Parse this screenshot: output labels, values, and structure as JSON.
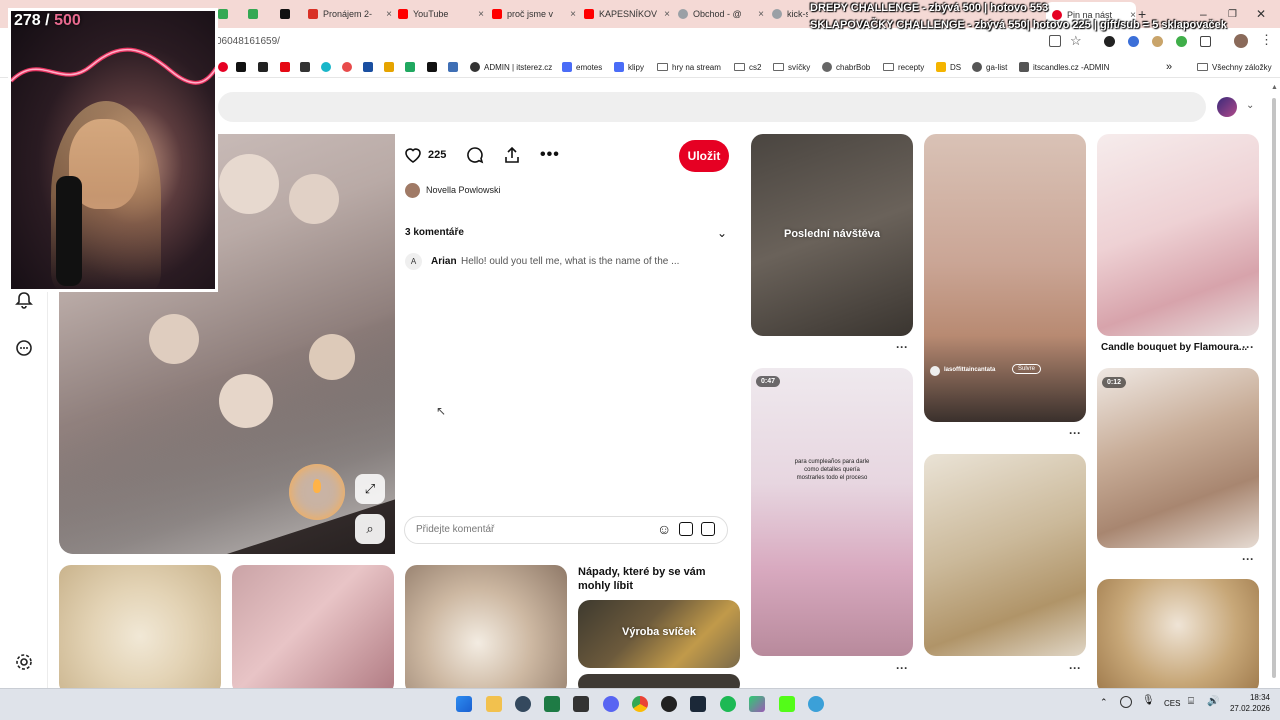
{
  "browser": {
    "tabs": [
      {
        "label": "Pronájem 2-",
        "color": "#d93025"
      },
      {
        "label": "YouTube",
        "color": "#ff0000"
      },
      {
        "label": "proč jsme v",
        "color": "#ff0000"
      },
      {
        "label": "KAPESNÍKOV",
        "color": "#ff0000"
      },
      {
        "label": "Obchod - @",
        "color": "#9aa0a6"
      },
      {
        "label": "kick-s",
        "color": "#9aa0a6"
      },
      {
        "label": "Pin na nást",
        "color": "#e60023"
      }
    ],
    "url": "06048161659/",
    "bookmarks": [
      {
        "label": "ADMIN | itsterez.cz",
        "color": "#333"
      },
      {
        "label": "emotes",
        "color": "#4a6cf7"
      },
      {
        "label": "klipy",
        "color": "#4a6cf7"
      },
      {
        "label": "hry na stream",
        "color": "folder"
      },
      {
        "label": "cs2",
        "color": "folder"
      },
      {
        "label": "svíčky",
        "color": "folder"
      },
      {
        "label": "chabrBob",
        "color": "#666"
      },
      {
        "label": "recepty",
        "color": "folder"
      },
      {
        "label": "DS",
        "color": "#f4b400"
      },
      {
        "label": "ga-list",
        "color": "#555"
      },
      {
        "label": "itscandles.cz -ADMIN",
        "color": "#555"
      }
    ],
    "all_bookmarks": "Všechny záložky"
  },
  "stream_overlay": {
    "line1": "DREPY CHALLENGE - zbývá 500 | hotovo 553",
    "line2": "SKLAPOVAČKY CHALLENGE - zbývá 550| hotovo 225 | gift/sub = 5 sklapovaček",
    "counter_current": "278",
    "counter_sep": "/",
    "counter_goal": "500"
  },
  "pin": {
    "likes": "225",
    "save_label": "Uložit",
    "author": "Novella Powlowski",
    "comments_header": "3 komentáře",
    "comment": {
      "avatar": "A",
      "user": "Arian",
      "text": "Hello! ould you tell me, what is the name of the ..."
    },
    "comment_placeholder": "Přidejte komentář"
  },
  "related": {
    "heading": "Nápady, které by se vám mohly líbit",
    "card_label": "Výroba svíček"
  },
  "grid": {
    "recent_label": "Poslední návštěva",
    "caption_3": "Candle bouquet by Flamoura...",
    "video_1": "0:47",
    "video_2": "0:12",
    "overlay_text": "para cumpleaños para darle como detalles quería mostrarles todo el proceso",
    "follow": "Sulvre",
    "handle": "lasoffittaincantata"
  },
  "taskbar": {
    "lang": "CES",
    "time": "18:34",
    "date": "27.02.2026"
  }
}
